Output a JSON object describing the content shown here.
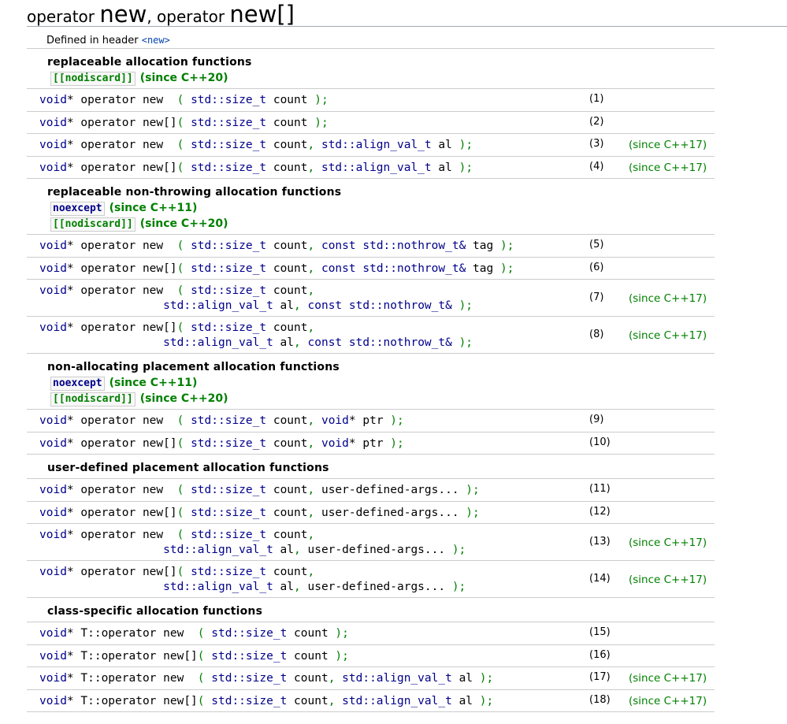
{
  "title": {
    "part1": "operator ",
    "part2": "new",
    "part3": ", operator ",
    "part4": "new[]"
  },
  "header": {
    "label": "Defined in header ",
    "link": "<new>"
  },
  "sections": [
    {
      "title": "replaceable allocation functions",
      "attrs": [
        {
          "box": "[[nodiscard]]",
          "since": "(since C++20)"
        }
      ],
      "rows": [
        {
          "num": "(1)",
          "since": ""
        },
        {
          "num": "(2)",
          "since": ""
        },
        {
          "num": "(3)",
          "since": "(since C++17)"
        },
        {
          "num": "(4)",
          "since": "(since C++17)"
        }
      ]
    },
    {
      "title": "replaceable non-throwing allocation functions",
      "attrs": [
        {
          "box": "noexcept",
          "since": "(since C++11)"
        },
        {
          "box": "[[nodiscard]]",
          "since": "(since C++20)"
        }
      ],
      "rows": [
        {
          "num": "(5)",
          "since": ""
        },
        {
          "num": "(6)",
          "since": ""
        },
        {
          "num": "(7)",
          "since": "(since C++17)"
        },
        {
          "num": "(8)",
          "since": "(since C++17)"
        }
      ]
    },
    {
      "title": "non-allocating placement allocation functions",
      "attrs": [
        {
          "box": "noexcept",
          "since": "(since C++11)"
        },
        {
          "box": "[[nodiscard]]",
          "since": "(since C++20)"
        }
      ],
      "rows": [
        {
          "num": "(9)",
          "since": ""
        },
        {
          "num": "(10)",
          "since": ""
        }
      ]
    },
    {
      "title": "user-defined placement allocation functions",
      "attrs": [],
      "rows": [
        {
          "num": "(11)",
          "since": ""
        },
        {
          "num": "(12)",
          "since": ""
        },
        {
          "num": "(13)",
          "since": "(since C++17)"
        },
        {
          "num": "(14)",
          "since": "(since C++17)"
        }
      ]
    },
    {
      "title": "class-specific allocation functions",
      "attrs": [],
      "rows": [
        {
          "num": "(15)",
          "since": ""
        },
        {
          "num": "(16)",
          "since": ""
        },
        {
          "num": "(17)",
          "since": "(since C++17)"
        },
        {
          "num": "(18)",
          "since": "(since C++17)"
        }
      ]
    }
  ],
  "code": {
    "void": "void",
    "star": "*",
    "op_new": " operator new  ",
    "op_newarr": " operator new[]",
    "t_op_new": " T::operator new  ",
    "t_op_newarr": " T::operator new[]",
    "open": "( ",
    "close": " );",
    "size_t": "std::size_t",
    "count": " count",
    "comma": ",",
    "align_val_t": "std::align_val_t",
    "al": " al",
    "const": "const",
    "nothrow_t": "std::nothrow_t&",
    "tag": " tag",
    "ptr": " ptr",
    "uda": " user-defined-args...",
    "indent": "                  "
  }
}
